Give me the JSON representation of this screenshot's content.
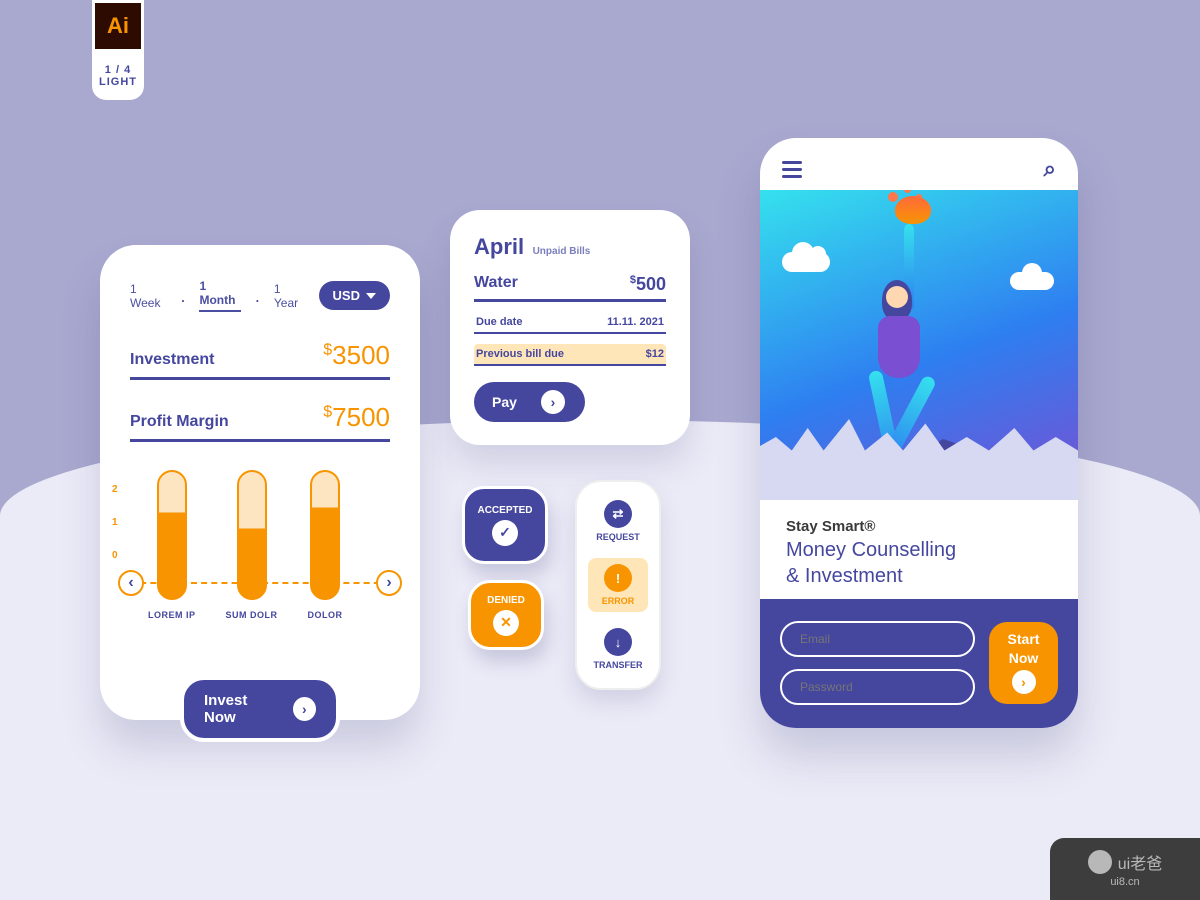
{
  "ai_label": {
    "icon_text": "Ai",
    "count": "1 / 4",
    "mode": "LIGHT"
  },
  "invest_card": {
    "tabs": [
      "1 Week",
      "1 Month",
      "1 Year"
    ],
    "active_tab": "1 Month",
    "currency": "USD",
    "stats": [
      {
        "label": "Investment",
        "value": "3500"
      },
      {
        "label": "Profit Margin",
        "value": "7500"
      }
    ],
    "chart": {
      "y_ticks": [
        "2",
        "1",
        "0"
      ],
      "bars": [
        "LOREM IP",
        "SUM DOLR",
        "DOLOR"
      ]
    },
    "cta": "Invest Now"
  },
  "bills_card": {
    "heading": "April",
    "subtitle": "Unpaid Bills",
    "main": {
      "name": "Water",
      "amount": "500"
    },
    "lines": [
      {
        "label": "Due date",
        "value": "11.11. 2021",
        "highlight": false
      },
      {
        "label": "Previous bill due",
        "value": "$12",
        "highlight": true
      }
    ],
    "cta": "Pay"
  },
  "chips": {
    "accepted": "ACCEPTED",
    "denied": "DENIED"
  },
  "badges": {
    "request": "REQUEST",
    "error": "ERROR",
    "transfer": "TRANSFER"
  },
  "phone": {
    "brand": "Stay Smart®",
    "tagline_l1": "Money Counselling",
    "tagline_l2": "& Investment",
    "email_placeholder": "Email",
    "password_placeholder": "Password",
    "start": "Start",
    "now": "Now"
  },
  "watermark": {
    "text": "ui老爸",
    "url": "ui8.cn"
  }
}
